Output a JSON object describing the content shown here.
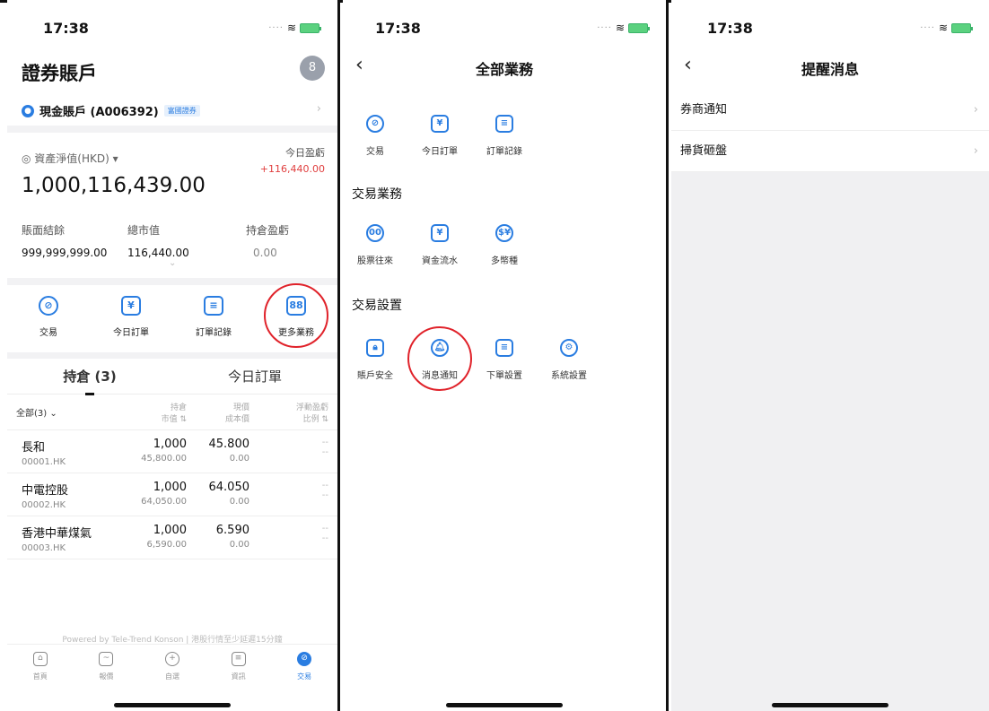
{
  "panel1": {
    "status_time": "17:38",
    "title": "證券賬戶",
    "avatar_glyph": "8",
    "account": {
      "label": "現金賬戶 (A006392)",
      "badge": "富國證券"
    },
    "assets": {
      "label": "資產淨值(HKD)",
      "value": "1,000,116,439.00",
      "today_label": "今日盈虧",
      "today_value": "+116,440.00"
    },
    "stats": [
      {
        "k": "賬面結餘",
        "v": "999,999,999.00"
      },
      {
        "k": "總市值",
        "v": "116,440.00"
      },
      {
        "k": "持倉盈虧",
        "v": "0.00"
      }
    ],
    "quick": [
      {
        "label": "交易",
        "glyph": "⊘"
      },
      {
        "label": "今日訂單",
        "glyph": "¥"
      },
      {
        "label": "訂單記錄",
        "glyph": "≡"
      },
      {
        "label": "更多業務",
        "glyph": "88"
      }
    ],
    "tabs": [
      "持倉 (3)",
      "今日訂單"
    ],
    "table_head": {
      "filter": "全部(3)",
      "c2a": "持倉",
      "c2b": "市值",
      "c3a": "現價",
      "c3b": "成本價",
      "c4a": "浮動盈虧",
      "c4b": "比例"
    },
    "holdings": [
      {
        "name": "長和",
        "code": "00001.HK",
        "qty": "1,000",
        "mv": "45,800.00",
        "price": "45.800",
        "cost": "0.00",
        "pl": "--",
        "ratio": "--"
      },
      {
        "name": "中電控股",
        "code": "00002.HK",
        "qty": "1,000",
        "mv": "64,050.00",
        "price": "64.050",
        "cost": "0.00",
        "pl": "--",
        "ratio": "--"
      },
      {
        "name": "香港中華煤氣",
        "code": "00003.HK",
        "qty": "1,000",
        "mv": "6,590.00",
        "price": "6.590",
        "cost": "0.00",
        "pl": "--",
        "ratio": "--"
      }
    ],
    "powered": "Powered by Tele-Trend Konson | 港股行情至少延遲15分鐘",
    "bottom_nav": [
      {
        "label": "首頁",
        "glyph": "⌂"
      },
      {
        "label": "報價",
        "glyph": "~"
      },
      {
        "label": "自選",
        "glyph": "+"
      },
      {
        "label": "資訊",
        "glyph": "≡"
      },
      {
        "label": "交易",
        "glyph": "⊘"
      }
    ]
  },
  "panel2": {
    "status_time": "17:38",
    "title": "全部業務",
    "top": [
      {
        "label": "交易",
        "glyph": "⊘"
      },
      {
        "label": "今日訂單",
        "glyph": "¥"
      },
      {
        "label": "訂單記錄",
        "glyph": "≡"
      }
    ],
    "section1": "交易業務",
    "business": [
      {
        "label": "股票往來",
        "glyph": "00"
      },
      {
        "label": "資金流水",
        "glyph": "¥"
      },
      {
        "label": "多幣種",
        "glyph": "$¥"
      }
    ],
    "section2": "交易設置",
    "settings": [
      {
        "label": "賬戶安全",
        "glyph": "🔒︎"
      },
      {
        "label": "消息通知",
        "glyph": "🔔︎"
      },
      {
        "label": "下單設置",
        "glyph": "≡"
      },
      {
        "label": "系統設置",
        "glyph": "⚙"
      }
    ]
  },
  "panel3": {
    "status_time": "17:38",
    "title": "提醒消息",
    "items": [
      "券商通知",
      "掃貨砸盤"
    ]
  }
}
